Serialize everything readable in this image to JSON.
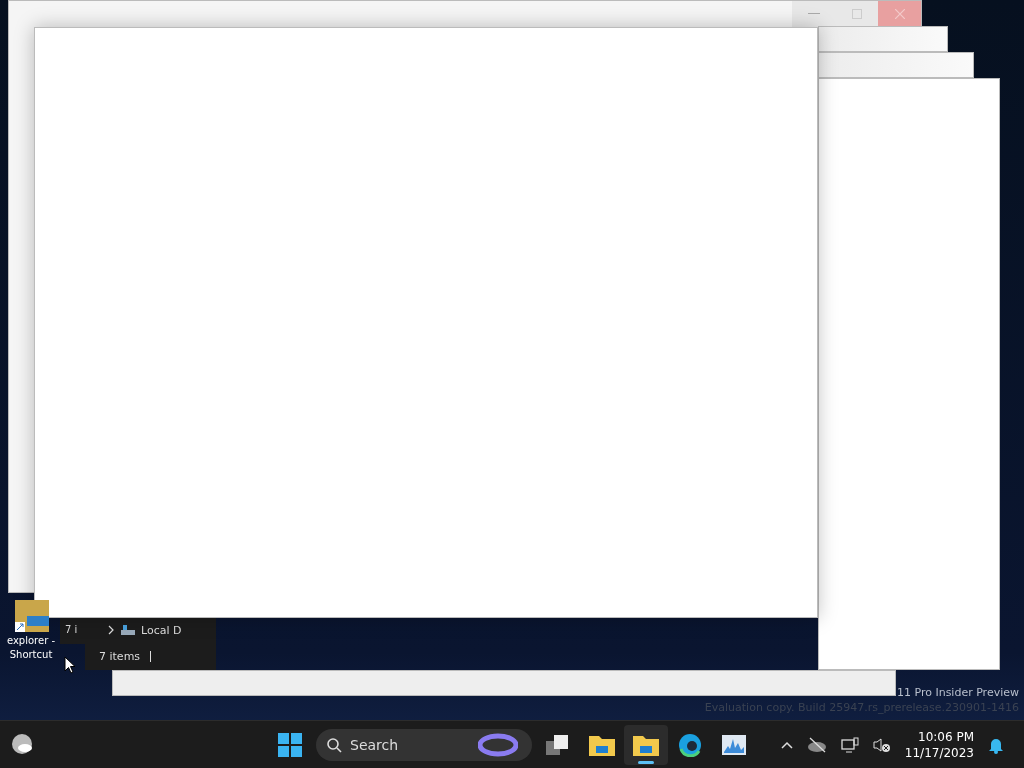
{
  "desktop_icons": [
    {
      "label": "explorer - Shortcut"
    }
  ],
  "explorer_windows": [
    {
      "status": "7 i"
    },
    {
      "nav_item": "Local D",
      "status": "7 items"
    }
  ],
  "watermark": [
    "11 Pro Insider Preview",
    "Evaluation copy. Build 25947.rs_prerelease.230901-1416"
  ],
  "taskbar": {
    "search": {
      "placeholder": "Search"
    },
    "apps": [
      {
        "kind": "taskview",
        "selected": false
      },
      {
        "kind": "folder",
        "selected": false
      },
      {
        "kind": "folder",
        "selected": true
      },
      {
        "kind": "edge",
        "selected": false
      },
      {
        "kind": "monitor",
        "selected": false
      }
    ],
    "clock": {
      "time": "10:06 PM",
      "date": "11/17/2023"
    }
  }
}
